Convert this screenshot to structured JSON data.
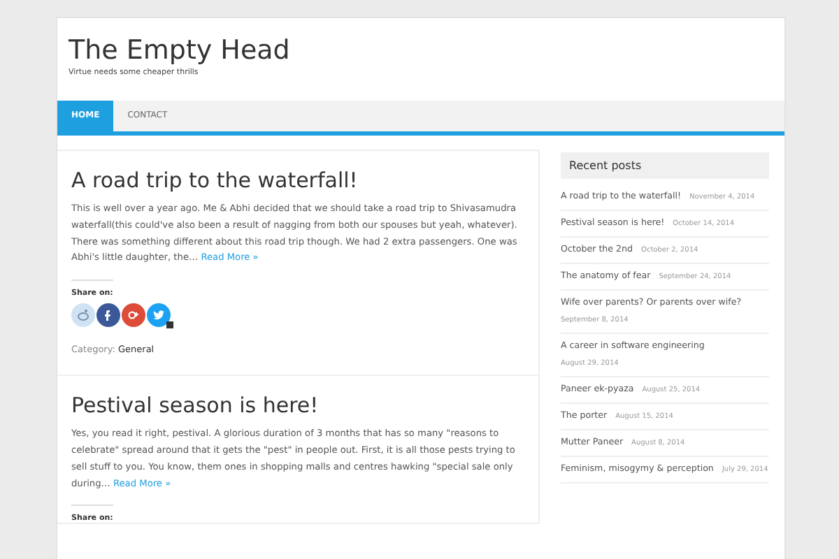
{
  "site": {
    "title": "The Empty Head",
    "tagline": "Virtue needs some cheaper thrills"
  },
  "nav": [
    {
      "label": "HOME",
      "selected": true
    },
    {
      "label": "CONTACT",
      "selected": false
    }
  ],
  "posts": [
    {
      "title": "A road trip to the waterfall!",
      "excerpt": "This is well over a year ago. Me & Abhi decided that we should take a road trip to Shivasamudra waterfall(this could've also been a result of nagging from both our spouses but yeah, whatever). There was something different about this road trip though. We had 2 extra passengers. One was Abhi's little daughter, the…",
      "read_more": "Read More »",
      "share_label": "Share on:",
      "share_buttons": true,
      "category_label": "Category:",
      "category": "General"
    },
    {
      "title": "Pestival season is here!",
      "excerpt": "Yes, you read it right, pestival. A glorious duration of 3 months that has so many \"reasons to celebrate\" spread around that it gets the \"pest\" in people out. First, it is all those pests trying to sell stuff to you. You know, them ones in shopping malls and centres hawking \"special sale only during…",
      "read_more": "Read More »",
      "share_label": "Share on:"
    }
  ],
  "sidebar": {
    "heading": "Recent posts",
    "items": [
      {
        "title": "A road trip to the waterfall!",
        "date": "November 4, 2014"
      },
      {
        "title": "Pestival season is here!",
        "date": "October 14, 2014"
      },
      {
        "title": "October the 2nd",
        "date": "October 2, 2014"
      },
      {
        "title": "The anatomy of fear",
        "date": "September 24, 2014"
      },
      {
        "title": "Wife over parents? Or parents over wife?",
        "date": "September 8, 2014"
      },
      {
        "title": "A career in software engineering",
        "date": "August 29, 2014"
      },
      {
        "title": "Paneer ek-pyaza",
        "date": "August 25, 2014"
      },
      {
        "title": "The porter",
        "date": "August 15, 2014"
      },
      {
        "title": "Mutter Paneer",
        "date": "August 8, 2014"
      },
      {
        "title": "Feminism, misogymy & perception",
        "date": "July 29, 2014"
      }
    ]
  }
}
